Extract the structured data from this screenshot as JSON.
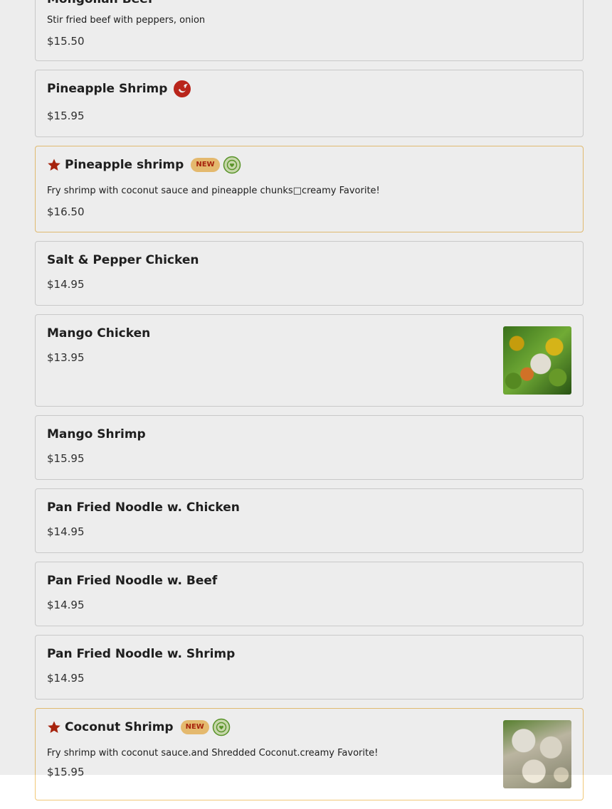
{
  "menu_items": [
    {
      "name": "Mongolian Beef",
      "description": "Stir fried beef with peppers, onion",
      "price": "$15.50"
    },
    {
      "name": "Pineapple Shrimp",
      "price": "$15.95",
      "icon": "chili-spicy-icon"
    },
    {
      "name": "Pineapple shrimp",
      "badge": "NEW",
      "description": "Fry shrimp with coconut sauce and pineapple chunks□creamy Favorite!",
      "price": "$16.50",
      "icons": [
        "star-icon",
        "favorite-heart-icon"
      ]
    },
    {
      "name": "Salt & Pepper Chicken",
      "price": "$14.95"
    },
    {
      "name": "Mango Chicken",
      "price": "$13.95",
      "image": "mango-chicken-photo"
    },
    {
      "name": "Mango Shrimp",
      "price": "$15.95"
    },
    {
      "name": "Pan Fried Noodle w. Chicken",
      "price": "$14.95"
    },
    {
      "name": "Pan Fried Noodle w. Beef",
      "price": "$14.95"
    },
    {
      "name": "Pan Fried Noodle w. Shrimp",
      "price": "$14.95"
    },
    {
      "name": "Coconut Shrimp",
      "badge": "NEW",
      "description": "Fry shrimp with coconut sauce.and Shredded Coconut.creamy Favorite!",
      "price": "$15.95",
      "icons": [
        "star-icon",
        "favorite-heart-icon"
      ],
      "image": "coconut-shrimp-photo"
    }
  ],
  "colors": {
    "star": "#b3260e",
    "spicy": "#c8281e",
    "badge_bg": "#f6c877",
    "badge_text": "#b3260e",
    "favorite": "#5e9e2a",
    "featured_border": "#f1c878"
  }
}
